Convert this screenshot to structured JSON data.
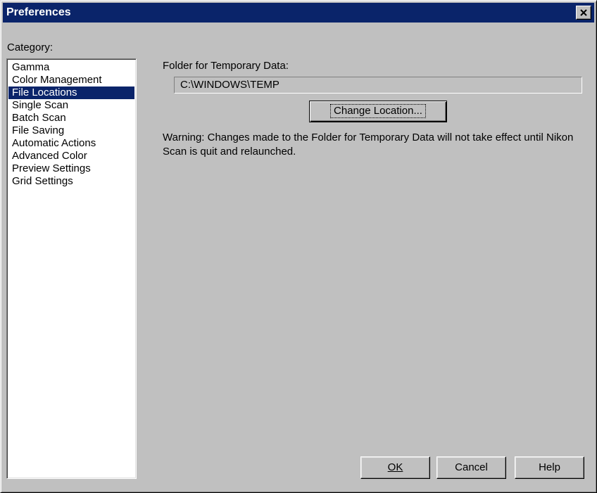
{
  "window": {
    "title": "Preferences"
  },
  "sidebar": {
    "label": "Category:",
    "items": [
      {
        "label": "Gamma"
      },
      {
        "label": "Color Management"
      },
      {
        "label": "File Locations",
        "selected": true
      },
      {
        "label": "Single Scan"
      },
      {
        "label": "Batch Scan"
      },
      {
        "label": "File Saving"
      },
      {
        "label": "Automatic Actions"
      },
      {
        "label": "Advanced Color"
      },
      {
        "label": "Preview Settings"
      },
      {
        "label": "Grid Settings"
      }
    ]
  },
  "main": {
    "folder_label": "Folder for Temporary Data:",
    "folder_path": "C:\\WINDOWS\\TEMP",
    "change_button": "Change Location...",
    "warning": "Warning: Changes made to the Folder for Temporary Data will not take effect until Nikon Scan is quit and relaunched."
  },
  "footer": {
    "ok": "OK",
    "cancel": "Cancel",
    "help": "Help"
  },
  "colors": {
    "titlebar": "#0a246a",
    "face": "#c0c0c0",
    "selection": "#0a246a"
  },
  "icons": {
    "close": "close-icon"
  }
}
